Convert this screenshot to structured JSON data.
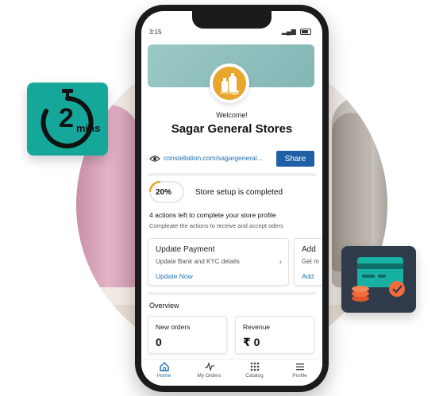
{
  "status_bar": {
    "time": "3:15"
  },
  "timer_badge": {
    "number": "2",
    "unit": "mins",
    "icon": "stopwatch-icon"
  },
  "payment_badge": {
    "icon": "credit-card-coins-check-icon"
  },
  "store": {
    "welcome": "Welcome!",
    "name": "Sagar General Stores",
    "link": "constellation.com/sagargeneral...",
    "share_label": "Share"
  },
  "progress": {
    "percent_label": "20%",
    "percent": 20,
    "text": "Store setup is completed"
  },
  "actions": {
    "title": "4 actions left to complete your store profile",
    "subtitle": "Compleate the actions to receive and accept oders",
    "cards": [
      {
        "title": "Update Payment",
        "desc": "Update Bank and KYC details",
        "link": "Update Now"
      },
      {
        "title": "Add",
        "desc": "Get m",
        "link": "Add"
      }
    ]
  },
  "overview": {
    "title": "Overview",
    "stats": [
      {
        "label": "New orders",
        "value": "0"
      },
      {
        "label": "Revenue",
        "value": "₹ 0"
      }
    ]
  },
  "nav": [
    {
      "label": "Home",
      "icon": "home-icon",
      "active": true
    },
    {
      "label": "My Orders",
      "icon": "activity-icon",
      "active": false
    },
    {
      "label": "Catalog",
      "icon": "grid-icon",
      "active": false
    },
    {
      "label": "Profile",
      "icon": "menu-icon",
      "active": false
    }
  ],
  "colors": {
    "accent": "#1f5fa6",
    "teal": "#15a89a",
    "progress": "#e9a52c",
    "link": "#1f6fb0"
  }
}
